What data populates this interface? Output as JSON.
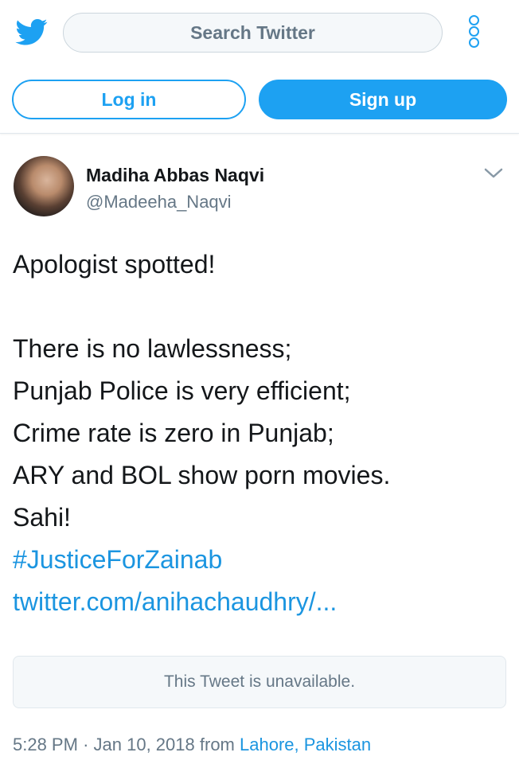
{
  "header": {
    "search_placeholder": "Search Twitter",
    "login_label": "Log in",
    "signup_label": "Sign up",
    "icons": {
      "logo": "twitter-bird-icon",
      "menu": "more-options-icon"
    }
  },
  "tweet": {
    "author_name": "Madiha Abbas Naqvi",
    "author_handle": "@Madeeha_Naqvi",
    "lines": [
      "Apologist spotted!",
      "",
      "There is no lawlessness;",
      "Punjab Police is very efficient;",
      "Crime rate is zero in Punjab;",
      "ARY and BOL show porn movies.",
      "Sahi!"
    ],
    "hashtag": "#JusticeForZainab",
    "link": "twitter.com/anihachaudhry/...",
    "quoted_card_text": "This Tweet is unavailable.",
    "time": "5:28 PM",
    "separator": "·",
    "date": "Jan 10, 2018",
    "from_label": "from",
    "location": "Lahore, Pakistan"
  },
  "colors": {
    "accent": "#1da1f2",
    "link": "#1b95e0",
    "muted": "#657786",
    "text": "#14171a"
  }
}
